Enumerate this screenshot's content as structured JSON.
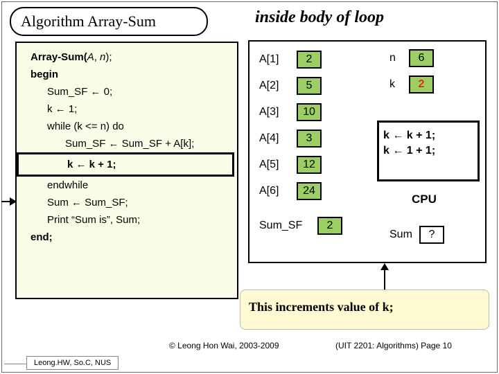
{
  "title": "Algorithm Array-Sum",
  "subtitle": "inside body of loop",
  "code": {
    "fn_signature_pre": "Array-Sum(",
    "fn_args_A": "A",
    "fn_args_sep": ", ",
    "fn_args_n": "n",
    "fn_signature_post": ");",
    "begin": "begin",
    "l1": "Sum_SF ← 0;",
    "l2": "k ← 1;",
    "l3": "while (k <= n) do",
    "l4": "Sum_SF ← Sum_SF + A[k];",
    "l5_highlight": "k ← k + 1;",
    "l6": "endwhile",
    "l7": "Sum ← Sum_SF;",
    "l8": "Print “Sum is”, Sum;",
    "end": "end;"
  },
  "state": {
    "array_rows": [
      {
        "label": "A[1]",
        "value": "2"
      },
      {
        "label": "A[2]",
        "value": "5"
      },
      {
        "label": "A[3]",
        "value": "10"
      },
      {
        "label": "A[4]",
        "value": "3"
      },
      {
        "label": "A[5]",
        "value": "12"
      },
      {
        "label": "A[6]",
        "value": "24"
      }
    ],
    "n_label": "n",
    "n_value": "6",
    "k_label": "k",
    "k_value": "2",
    "sumsf_label": "Sum_SF",
    "sumsf_value": "2",
    "sum_label": "Sum",
    "sum_value": "?"
  },
  "cpu": {
    "line1": "k ← k + 1;",
    "line2": "k ← 1 + 1;",
    "label": "CPU"
  },
  "callout": "This increments value of k;",
  "footer": {
    "copyright": "© Leong Hon Wai, 2003-2009",
    "page": "(UIT 2201: Algorithms) Page 10",
    "author": "Leong.HW, So.C, NUS"
  }
}
